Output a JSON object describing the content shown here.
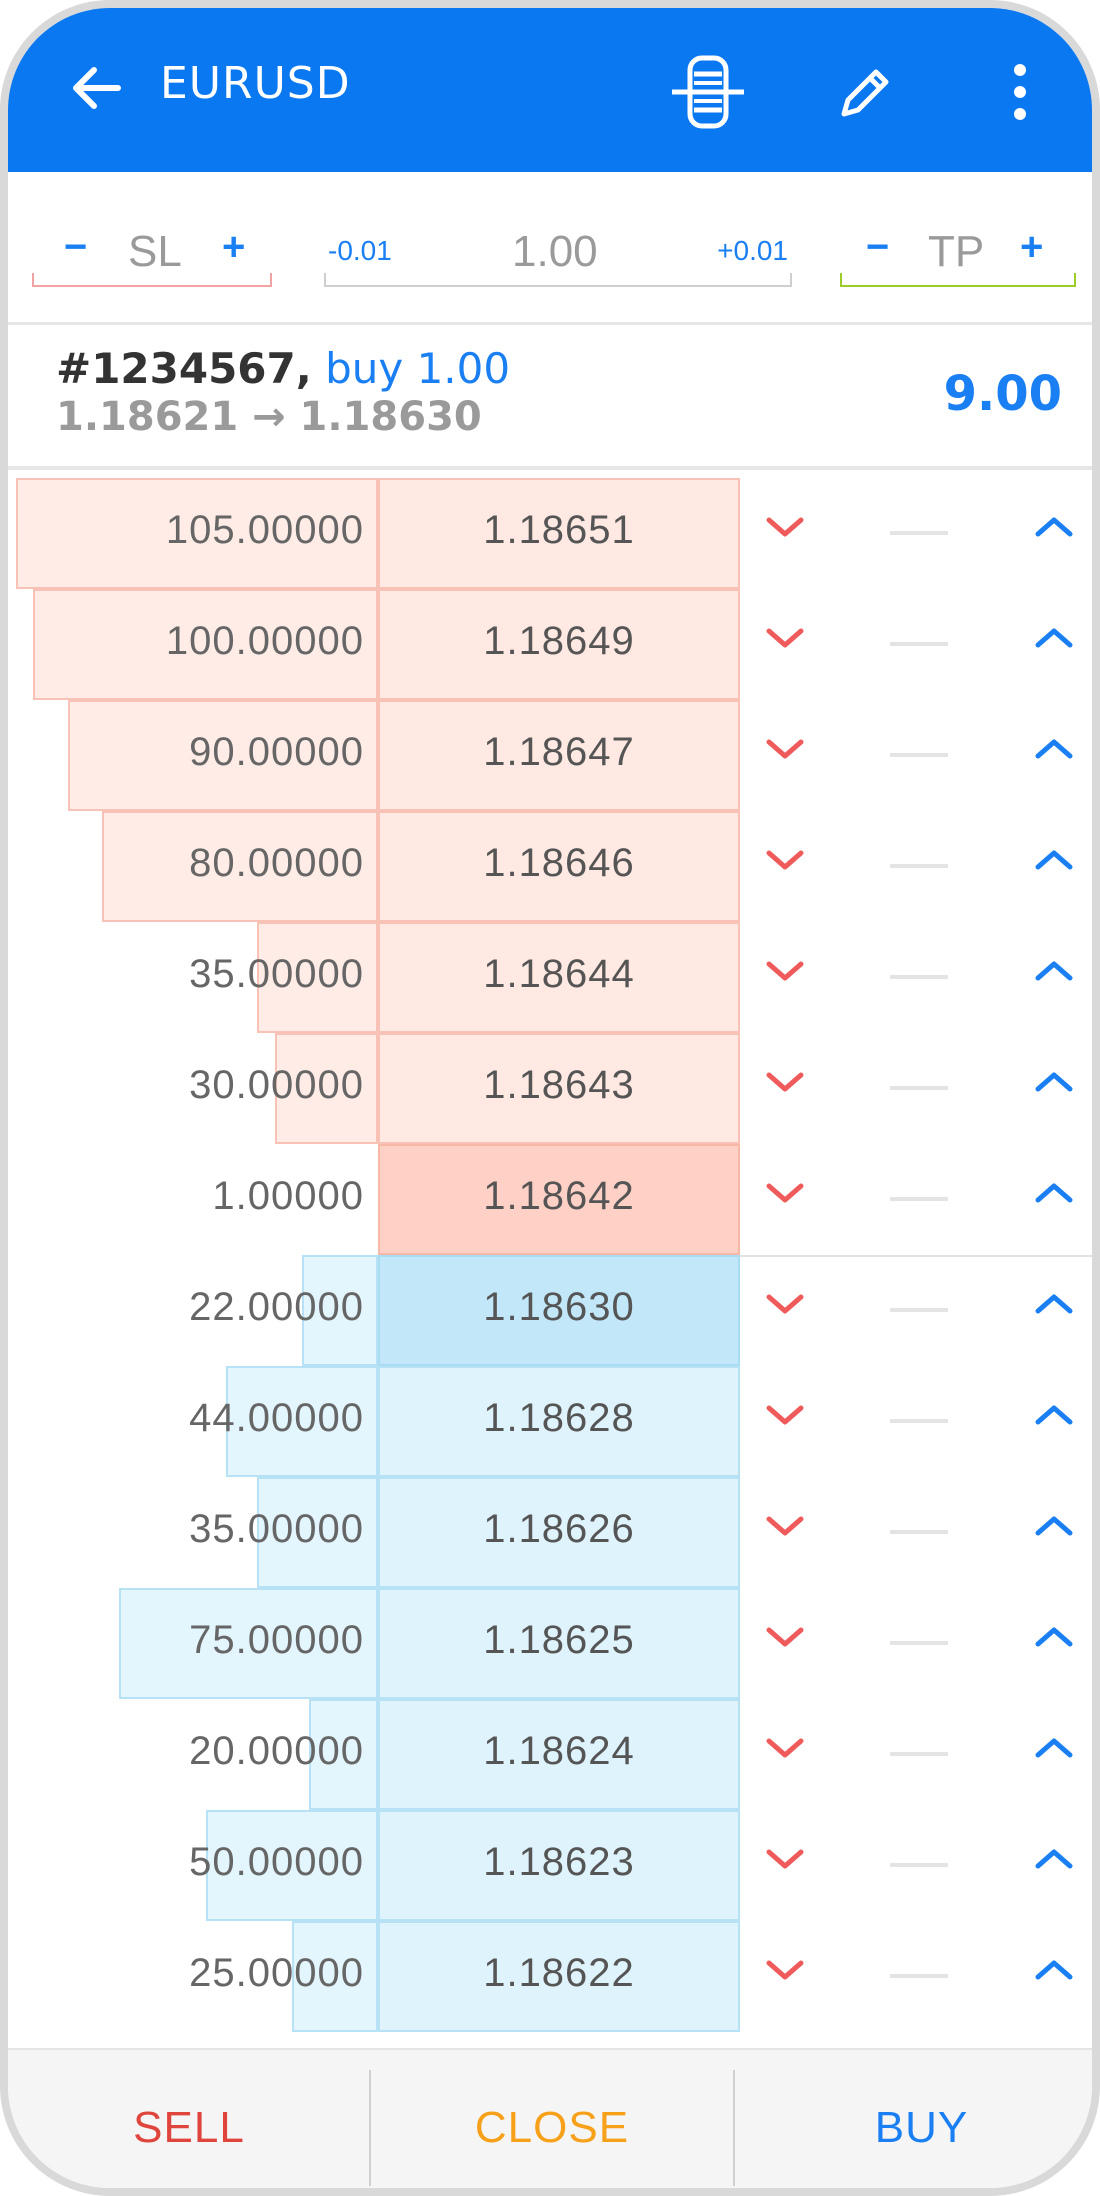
{
  "header": {
    "title": "EURUSD",
    "colors": {
      "bar": "#0a78f0",
      "icon": "#ffffff"
    },
    "icons": [
      "back-arrow-icon",
      "depth-of-market-icon",
      "edit-pencil-icon",
      "more-vert-icon"
    ]
  },
  "controls": {
    "sl": {
      "minus": "−",
      "label": "SL",
      "plus": "+"
    },
    "volume": {
      "dec": "-0.01",
      "value": "1.00",
      "inc": "+0.01"
    },
    "tp": {
      "minus": "−",
      "label": "TP",
      "plus": "+"
    }
  },
  "position": {
    "ticket": "#1234567,",
    "side": "buy 1.00",
    "prices": "1.18621 → 1.18630",
    "profit": "9.00"
  },
  "depth": {
    "asks": [
      {
        "volume": "105.00000",
        "price": "1.18651",
        "vol": 105
      },
      {
        "volume": "100.00000",
        "price": "1.18649",
        "vol": 100
      },
      {
        "volume": "90.00000",
        "price": "1.18647",
        "vol": 90
      },
      {
        "volume": "80.00000",
        "price": "1.18646",
        "vol": 80
      },
      {
        "volume": "35.00000",
        "price": "1.18644",
        "vol": 35
      },
      {
        "volume": "30.00000",
        "price": "1.18643",
        "vol": 30
      },
      {
        "volume": "1.00000",
        "price": "1.18642",
        "vol": 1
      }
    ],
    "bids": [
      {
        "volume": "22.00000",
        "price": "1.18630",
        "vol": 22
      },
      {
        "volume": "44.00000",
        "price": "1.18628",
        "vol": 44
      },
      {
        "volume": "35.00000",
        "price": "1.18626",
        "vol": 35
      },
      {
        "volume": "75.00000",
        "price": "1.18625",
        "vol": 75
      },
      {
        "volume": "20.00000",
        "price": "1.18624",
        "vol": 20
      },
      {
        "volume": "50.00000",
        "price": "1.18623",
        "vol": 50
      },
      {
        "volume": "25.00000",
        "price": "1.18622",
        "vol": 25
      }
    ],
    "colors": {
      "down": "#ef5a5a",
      "up": "#1a7ff2"
    }
  },
  "bottom": {
    "sell": "SELL",
    "close": "CLOSE",
    "buy": "BUY",
    "colors": {
      "sell": "#e0453d",
      "close": "#f7a11a",
      "buy": "#1a7ff2"
    }
  }
}
